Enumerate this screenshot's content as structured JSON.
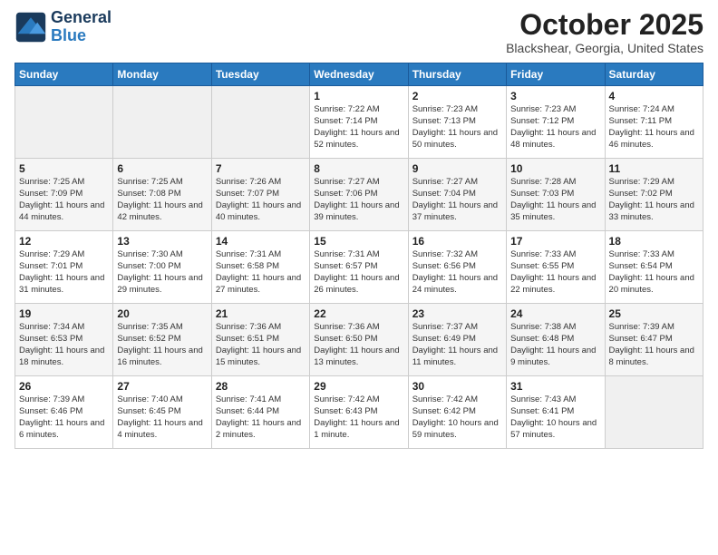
{
  "header": {
    "logo_general": "General",
    "logo_blue": "Blue",
    "month": "October 2025",
    "location": "Blackshear, Georgia, United States"
  },
  "days_of_week": [
    "Sunday",
    "Monday",
    "Tuesday",
    "Wednesday",
    "Thursday",
    "Friday",
    "Saturday"
  ],
  "weeks": [
    [
      {
        "day": "",
        "info": ""
      },
      {
        "day": "",
        "info": ""
      },
      {
        "day": "",
        "info": ""
      },
      {
        "day": "1",
        "info": "Sunrise: 7:22 AM\nSunset: 7:14 PM\nDaylight: 11 hours and 52 minutes."
      },
      {
        "day": "2",
        "info": "Sunrise: 7:23 AM\nSunset: 7:13 PM\nDaylight: 11 hours and 50 minutes."
      },
      {
        "day": "3",
        "info": "Sunrise: 7:23 AM\nSunset: 7:12 PM\nDaylight: 11 hours and 48 minutes."
      },
      {
        "day": "4",
        "info": "Sunrise: 7:24 AM\nSunset: 7:11 PM\nDaylight: 11 hours and 46 minutes."
      }
    ],
    [
      {
        "day": "5",
        "info": "Sunrise: 7:25 AM\nSunset: 7:09 PM\nDaylight: 11 hours and 44 minutes."
      },
      {
        "day": "6",
        "info": "Sunrise: 7:25 AM\nSunset: 7:08 PM\nDaylight: 11 hours and 42 minutes."
      },
      {
        "day": "7",
        "info": "Sunrise: 7:26 AM\nSunset: 7:07 PM\nDaylight: 11 hours and 40 minutes."
      },
      {
        "day": "8",
        "info": "Sunrise: 7:27 AM\nSunset: 7:06 PM\nDaylight: 11 hours and 39 minutes."
      },
      {
        "day": "9",
        "info": "Sunrise: 7:27 AM\nSunset: 7:04 PM\nDaylight: 11 hours and 37 minutes."
      },
      {
        "day": "10",
        "info": "Sunrise: 7:28 AM\nSunset: 7:03 PM\nDaylight: 11 hours and 35 minutes."
      },
      {
        "day": "11",
        "info": "Sunrise: 7:29 AM\nSunset: 7:02 PM\nDaylight: 11 hours and 33 minutes."
      }
    ],
    [
      {
        "day": "12",
        "info": "Sunrise: 7:29 AM\nSunset: 7:01 PM\nDaylight: 11 hours and 31 minutes."
      },
      {
        "day": "13",
        "info": "Sunrise: 7:30 AM\nSunset: 7:00 PM\nDaylight: 11 hours and 29 minutes."
      },
      {
        "day": "14",
        "info": "Sunrise: 7:31 AM\nSunset: 6:58 PM\nDaylight: 11 hours and 27 minutes."
      },
      {
        "day": "15",
        "info": "Sunrise: 7:31 AM\nSunset: 6:57 PM\nDaylight: 11 hours and 26 minutes."
      },
      {
        "day": "16",
        "info": "Sunrise: 7:32 AM\nSunset: 6:56 PM\nDaylight: 11 hours and 24 minutes."
      },
      {
        "day": "17",
        "info": "Sunrise: 7:33 AM\nSunset: 6:55 PM\nDaylight: 11 hours and 22 minutes."
      },
      {
        "day": "18",
        "info": "Sunrise: 7:33 AM\nSunset: 6:54 PM\nDaylight: 11 hours and 20 minutes."
      }
    ],
    [
      {
        "day": "19",
        "info": "Sunrise: 7:34 AM\nSunset: 6:53 PM\nDaylight: 11 hours and 18 minutes."
      },
      {
        "day": "20",
        "info": "Sunrise: 7:35 AM\nSunset: 6:52 PM\nDaylight: 11 hours and 16 minutes."
      },
      {
        "day": "21",
        "info": "Sunrise: 7:36 AM\nSunset: 6:51 PM\nDaylight: 11 hours and 15 minutes."
      },
      {
        "day": "22",
        "info": "Sunrise: 7:36 AM\nSunset: 6:50 PM\nDaylight: 11 hours and 13 minutes."
      },
      {
        "day": "23",
        "info": "Sunrise: 7:37 AM\nSunset: 6:49 PM\nDaylight: 11 hours and 11 minutes."
      },
      {
        "day": "24",
        "info": "Sunrise: 7:38 AM\nSunset: 6:48 PM\nDaylight: 11 hours and 9 minutes."
      },
      {
        "day": "25",
        "info": "Sunrise: 7:39 AM\nSunset: 6:47 PM\nDaylight: 11 hours and 8 minutes."
      }
    ],
    [
      {
        "day": "26",
        "info": "Sunrise: 7:39 AM\nSunset: 6:46 PM\nDaylight: 11 hours and 6 minutes."
      },
      {
        "day": "27",
        "info": "Sunrise: 7:40 AM\nSunset: 6:45 PM\nDaylight: 11 hours and 4 minutes."
      },
      {
        "day": "28",
        "info": "Sunrise: 7:41 AM\nSunset: 6:44 PM\nDaylight: 11 hours and 2 minutes."
      },
      {
        "day": "29",
        "info": "Sunrise: 7:42 AM\nSunset: 6:43 PM\nDaylight: 11 hours and 1 minute."
      },
      {
        "day": "30",
        "info": "Sunrise: 7:42 AM\nSunset: 6:42 PM\nDaylight: 10 hours and 59 minutes."
      },
      {
        "day": "31",
        "info": "Sunrise: 7:43 AM\nSunset: 6:41 PM\nDaylight: 10 hours and 57 minutes."
      },
      {
        "day": "",
        "info": ""
      }
    ]
  ]
}
